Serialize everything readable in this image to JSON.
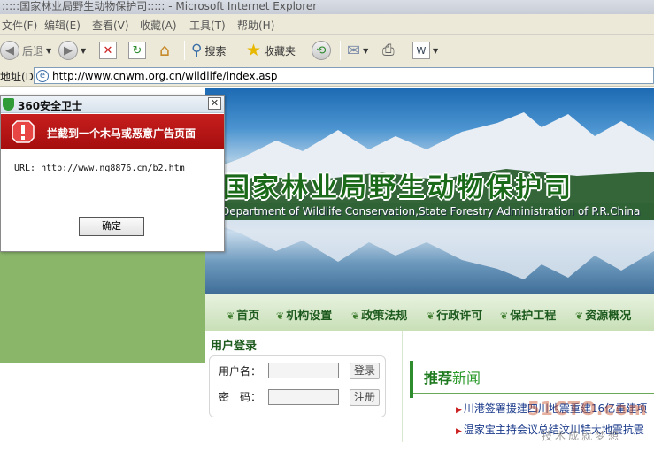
{
  "window": {
    "title": ":::::国家林业局野生动物保护司:::::  - Microsoft Internet Explorer"
  },
  "menu": [
    "文件(F)",
    "编辑(E)",
    "查看(V)",
    "收藏(A)",
    "工具(T)",
    "帮助(H)"
  ],
  "toolbar": {
    "back_label": "后退",
    "search_label": "搜索",
    "favorites_label": "收藏夹"
  },
  "address": {
    "label": "地址(D)",
    "url": "http://www.cnwm.org.cn/wildlife/index.asp"
  },
  "banner": {
    "title": "国家林业局野生动物保护司",
    "subtitle": "Department of Wildlife Conservation,State Forestry Administration of P.R.China"
  },
  "nav": [
    "首页",
    "机构设置",
    "政策法规",
    "行政许可",
    "保护工程",
    "资源概况"
  ],
  "login": {
    "title": "用户登录",
    "username_label": "用户名：",
    "password_label": "密　码：",
    "login_button": "登录",
    "register_button": "注册"
  },
  "recommend": {
    "title_part1": "推荐",
    "title_part2": "新闻",
    "items": [
      "川港签署援建四川地震重建16亿重建项",
      "温家宝主持会议总结汶川特大地震抗震"
    ]
  },
  "watermark": {
    "main": "51CTO.com",
    "sub": "技术成就梦想"
  },
  "dialog": {
    "title": "360安全卫士",
    "close": "✕",
    "alert": "拦截到一个木马或恶意广告页面",
    "url_text": "URL: http://www.ng8876.cn/b2.htm",
    "ok_button": "确定"
  },
  "colors": {
    "alert_red": "#b51414",
    "page_green": "#8ab66a",
    "title_green": "#1a6a1a"
  }
}
